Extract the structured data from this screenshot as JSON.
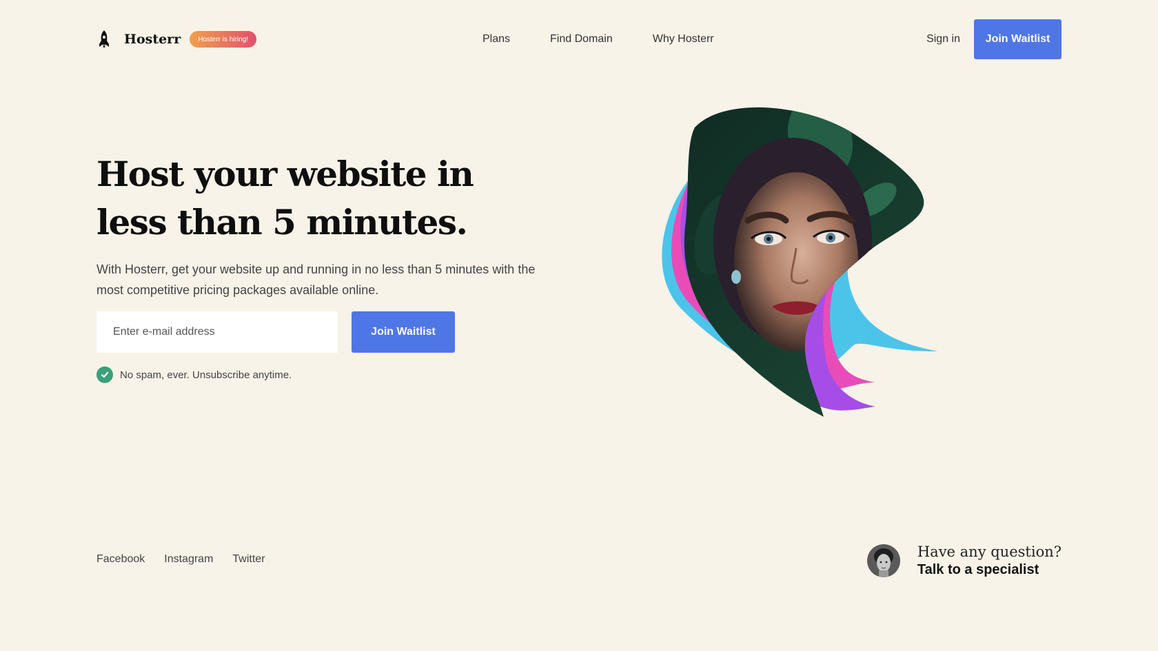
{
  "header": {
    "brand": "Hosterr",
    "hiring_badge": "Hosterr is hiring!",
    "nav": [
      {
        "label": "Plans"
      },
      {
        "label": "Find Domain"
      },
      {
        "label": "Why Hosterr"
      }
    ],
    "sign_in": "Sign in",
    "cta": "Join Waitlist"
  },
  "hero": {
    "headline": "Host your website in less than 5 minutes.",
    "subtext": "With Hosterr, get your website up and running in no less than 5 minutes with the most competitive pricing packages available online.",
    "email_placeholder": "Enter e-mail address",
    "cta": "Join Waitlist",
    "no_spam": "No spam, ever. Unsubscribe anytime."
  },
  "footer": {
    "social": [
      {
        "label": "Facebook"
      },
      {
        "label": "Instagram"
      },
      {
        "label": "Twitter"
      }
    ],
    "question": "Have any question?",
    "specialist_cta": "Talk to a specialist"
  },
  "colors": {
    "background": "#f8f3e8",
    "primary": "#4f76e6",
    "check": "#3a9f7a",
    "badge_start": "#f0a04b",
    "badge_end": "#e3506c",
    "blob_cyan": "#4cc4ea",
    "blob_pink": "#e94cb8",
    "blob_purple": "#a64de8"
  },
  "icons": {
    "logo": "rocket-icon",
    "check": "check-circle-icon"
  }
}
